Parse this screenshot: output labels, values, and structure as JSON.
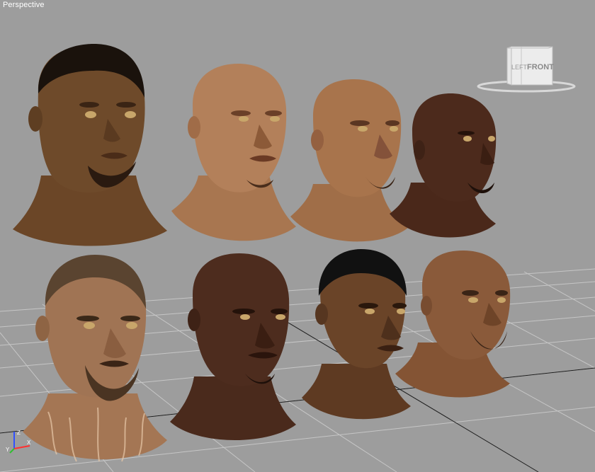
{
  "viewport": {
    "label": "Perspective",
    "background": "#9d9d9d",
    "grid_color": "#c8c8c8"
  },
  "viewcube": {
    "front_label": "FRONT",
    "left_label": "LEFT"
  },
  "axis_gizmo": {
    "x_label": "X",
    "y_label": "Y",
    "z_label": "Z"
  },
  "heads": [
    {
      "name": "head-1",
      "skin": "#6e4a2a",
      "hair": "#1a120c"
    },
    {
      "name": "head-2",
      "skin": "#b3805a",
      "hair": null
    },
    {
      "name": "head-3",
      "skin": "#a8744c",
      "hair": null
    },
    {
      "name": "head-4",
      "skin": "#4c2a1c",
      "hair": null
    },
    {
      "name": "head-5",
      "skin": "#a07454",
      "hair": "#5a4430"
    },
    {
      "name": "head-6",
      "skin": "#4d2c1e",
      "hair": null
    },
    {
      "name": "head-7",
      "skin": "#6a4428",
      "hair": "#111111"
    },
    {
      "name": "head-8",
      "skin": "#8a5a3a",
      "hair": null
    }
  ]
}
